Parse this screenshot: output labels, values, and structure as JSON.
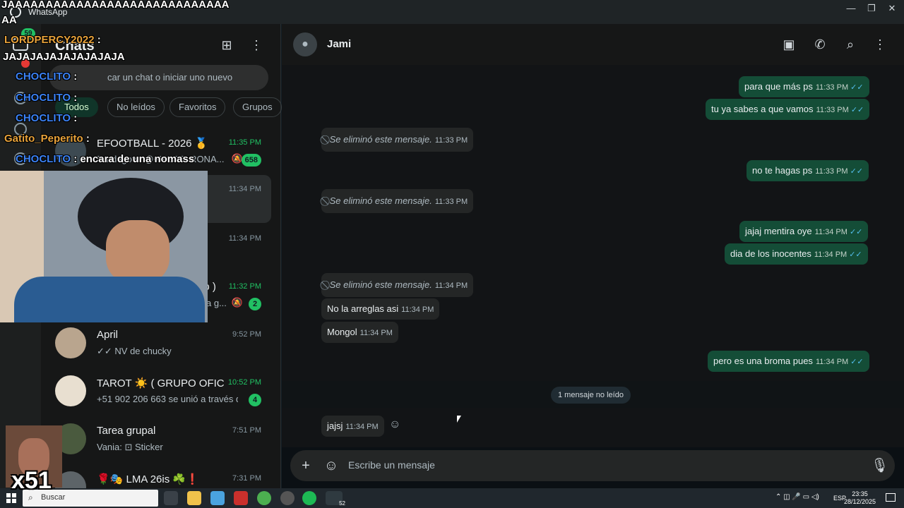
{
  "window": {
    "title": "WhatsApp",
    "minimize": "—",
    "maximize": "❐",
    "close": "✕"
  },
  "chat_list": {
    "title": "Chats",
    "search_placeholder": "car un chat o iniciar uno nuevo",
    "filters": [
      "Todos",
      "No leídos",
      "Favoritos",
      "Grupos"
    ],
    "rows": [
      {
        "name": "EFOOTBALL - 2026 🥇",
        "time": "11:35 PM",
        "preview": "Dardagots: @~MESSI RONA...",
        "badge": "658",
        "muted": true
      },
      {
        "name": "",
        "time": "11:34 PM",
        "preview": ""
      },
      {
        "name": "",
        "time": "11:34 PM",
        "preview": ""
      },
      {
        "name": "po )",
        "time": "11:32 PM",
        "preview": "a g...",
        "badge": "2",
        "muted": true
      },
      {
        "name": "April",
        "time": "9:52 PM",
        "preview": "✓✓ NV de chucky"
      },
      {
        "name": "TAROT ☀️ ( GRUPO OFICI...",
        "time": "10:52 PM",
        "preview": "+51 902 206 663 se unió a través d...",
        "badge": "4"
      },
      {
        "name": "Tarea grupal",
        "time": "7:51 PM",
        "preview": "Vania: ⊡ Sticker"
      },
      {
        "name": "🌹🎭 LMA 26is ☘️❗",
        "time": "7:31 PM",
        "preview": ""
      }
    ]
  },
  "conversation": {
    "name": "Jami",
    "messages": [
      {
        "dir": "out",
        "text": "para que más ps",
        "time": "11:33 PM"
      },
      {
        "dir": "out",
        "text": "tu ya sabes a que vamos",
        "time": "11:33 PM"
      },
      {
        "dir": "in",
        "deleted": true,
        "text": "Se eliminó este mensaje.",
        "time": "11:33 PM"
      },
      {
        "dir": "out",
        "text": "no te hagas ps",
        "time": "11:33 PM"
      },
      {
        "dir": "in",
        "deleted": true,
        "text": "Se eliminó este mensaje.",
        "time": "11:33 PM"
      },
      {
        "dir": "out",
        "text": "jajaj mentira oye",
        "time": "11:34 PM"
      },
      {
        "dir": "out",
        "text": "dia de los inocentes",
        "time": "11:34 PM"
      },
      {
        "dir": "in",
        "deleted": true,
        "text": "Se eliminó este mensaje.",
        "time": "11:34 PM"
      },
      {
        "dir": "in",
        "text": "No la arreglas asi",
        "time": "11:34 PM"
      },
      {
        "dir": "in",
        "text": "Mongol",
        "time": "11:34 PM"
      },
      {
        "dir": "out",
        "text": "pero es una broma pues",
        "time": "11:34 PM"
      },
      {
        "dir": "in",
        "text": "jajsj",
        "time": "11:34 PM"
      }
    ],
    "unread_label": "1 mensaje no leído",
    "composer_placeholder": "Escribe un mensaje"
  },
  "taskbar": {
    "search_label": "Buscar",
    "lang": "ESP",
    "time": "23:35",
    "date": "28/12/2025",
    "whatsapp_count": "52"
  },
  "overlay": {
    "top_line1": "JAAAAAAAAAAAAAAAAAAAAAAAAAAAAA",
    "top_line2": "AA",
    "rail_badge": "59",
    "user1": "LORDPERCY2022",
    "user1_msg": "JAJAJAJAJAJAJAJAJA",
    "user2": "CHOCLITO",
    "user3": "Gatito_Peperito",
    "last_msg": "encara de una nomass",
    "multiplier": "x51"
  },
  "colors": {
    "accent": "#21c063",
    "outgoing_bubble": "#144d37",
    "incoming_bubble": "#242626",
    "read_ticks": "#53bdeb"
  }
}
